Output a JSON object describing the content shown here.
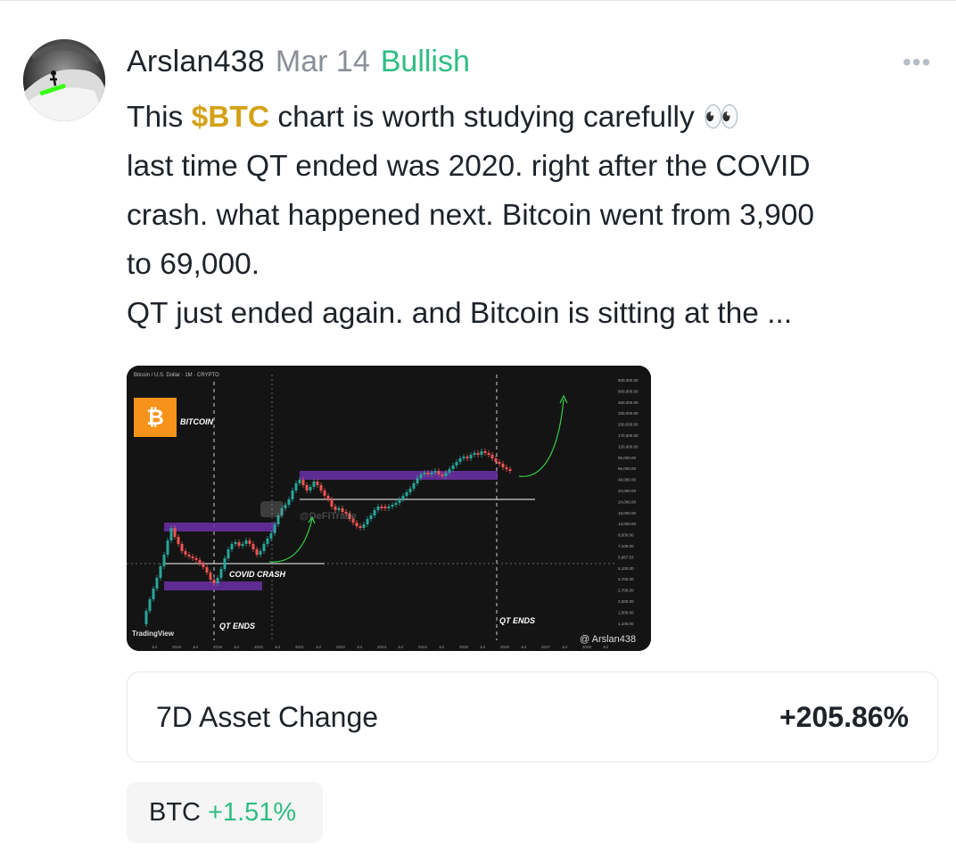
{
  "post": {
    "author": "Arslan438",
    "date": "Mar 14",
    "sentiment": "Bullish",
    "more_label": "•••",
    "lines": {
      "l1_pre": "This ",
      "l1_ticker": "$BTC",
      "l1_post": " chart is worth studying carefully 👀",
      "l2": "last time QT ended was 2020. right after the COVID",
      "l3": "crash. what happened next. Bitcoin went from 3,900",
      "l4": "to 69,000.",
      "l5": "QT just ended again. and Bitcoin is sitting at the ..."
    }
  },
  "chart_image": {
    "symbol_line": "Bitcoin / U.S. Dollar · 1M · CRYPTO",
    "coin_label": "BITCOIN",
    "covid_label": "COVID CRASH",
    "qt_label_1": "QT ENDS",
    "qt_label_2": "QT ENDS",
    "watermark": "@DeFiTrade",
    "tv_logo": "TradingView",
    "credit": "@ Arslan438",
    "price_ticks": [
      "800,000.00",
      "600,000.00",
      "450,000.00",
      "330,000.00",
      "230,000.00",
      "170,000.00",
      "120,000.00",
      "90,000.00",
      "66,000.00",
      "48,000.00",
      "34,000.00",
      "24,000.00",
      "18,000.00",
      "13,000.00",
      "9,500.00",
      "7,100.00",
      "5,987.53",
      "5,100.00",
      "3,700.00",
      "2,700.00",
      "2,000.00",
      "1,500.00",
      "1,100.00"
    ],
    "time_ticks": [
      "Jul",
      "2018",
      "Jul",
      "2019",
      "Jul",
      "2020",
      "Jul",
      "2021",
      "Jul",
      "2022",
      "Jul",
      "2023",
      "Jul",
      "2024",
      "Jul",
      "2025",
      "Jul",
      "2026",
      "Jul",
      "2027",
      "Jul",
      "2028",
      "Jul"
    ],
    "colors": {
      "up": "#26a69a",
      "down": "#ef5350",
      "zone": "#6b2fa8",
      "arrow": "#35d24a",
      "badge": "#f7931a"
    }
  },
  "asset_card": {
    "label": "7D Asset Change",
    "value": "+205.86%"
  },
  "chip": {
    "symbol": "BTC",
    "change": "+1.51%"
  }
}
